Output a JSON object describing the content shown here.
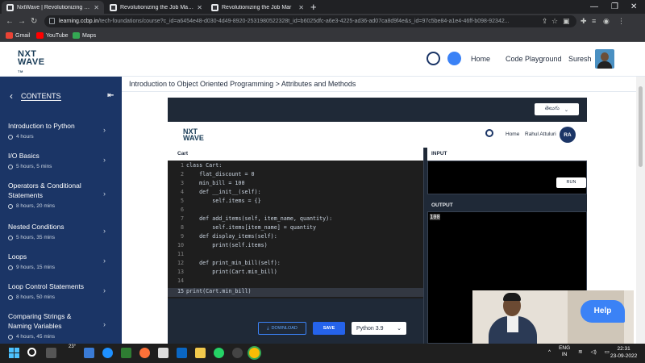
{
  "browser": {
    "tabs": [
      {
        "title": "NxtWave | Revolutionizing the Job"
      },
      {
        "title": "Revolutionizing the Job Market | "
      },
      {
        "title": "Revolutionizing the Job Mar"
      }
    ],
    "url_host": "learning.ccbp.in",
    "url_path": "/tech-foundations/course?c_id=a6454e48-d030-4d49-8920-2531980522328t_id=b6025dfc-a6e3-4225-ad36-ad07ca8d9f4e&s_id=97c5be84-a1e4-46ff-b098-92342...",
    "bookmarks": [
      "Gmail",
      "YouTube",
      "Maps"
    ]
  },
  "header": {
    "logo": "NXT WAVE",
    "logo_tm": "TM",
    "nav": [
      "Home",
      "Code Playground"
    ],
    "user": "Suresh"
  },
  "sidebar": {
    "title": "CONTENTS",
    "modules": [
      {
        "title": "Introduction to Python",
        "duration": "4 hours"
      },
      {
        "title": "I/O Basics",
        "duration": "5 hours, 5 mins"
      },
      {
        "title": "Operators & Conditional Statements",
        "duration": "8 hours, 20 mins"
      },
      {
        "title": "Nested Conditions",
        "duration": "5 hours, 35 mins"
      },
      {
        "title": "Loops",
        "duration": "9 hours, 15 mins"
      },
      {
        "title": "Loop Control Statements",
        "duration": "8 hours, 50 mins"
      },
      {
        "title": "Comparing Strings & Naming Variables",
        "duration": "4 hours, 45 mins"
      }
    ]
  },
  "breadcrumb": "Introduction to Object Oriented Programming > Attributes and Methods",
  "embed": {
    "language_select": "తెలుగు",
    "logo": "NXT WAVE",
    "nav_home": "Home",
    "user_name": "Rahul Attuluri",
    "user_initials": "RA",
    "editor_label": "Cart",
    "input_label": "INPUT",
    "output_label": "OUTPUT",
    "run_label": "RUN",
    "output_value": "100",
    "download_label": "DOWNLOAD",
    "save_label": "SAVE",
    "python_version": "Python 3.9"
  },
  "code_lines": [
    "class Cart:",
    "    flat_discount = 0",
    "    min_bill = 100",
    "    def __init__(self):",
    "        self.items = {}",
    "",
    "    def add_items(self, item_name, quantity):",
    "        self.items[item_name] = quantity",
    "    def display_items(self):",
    "        print(self.items)",
    "",
    "    def print_min_bill(self):",
    "        print(Cart.min_bill)",
    "",
    "print(Cart.min_bill)"
  ],
  "help_label": "Help",
  "taskbar": {
    "temperature": "23°",
    "language": "ENG",
    "region": "IN",
    "time": "22:31",
    "date": "23-09-2022"
  }
}
